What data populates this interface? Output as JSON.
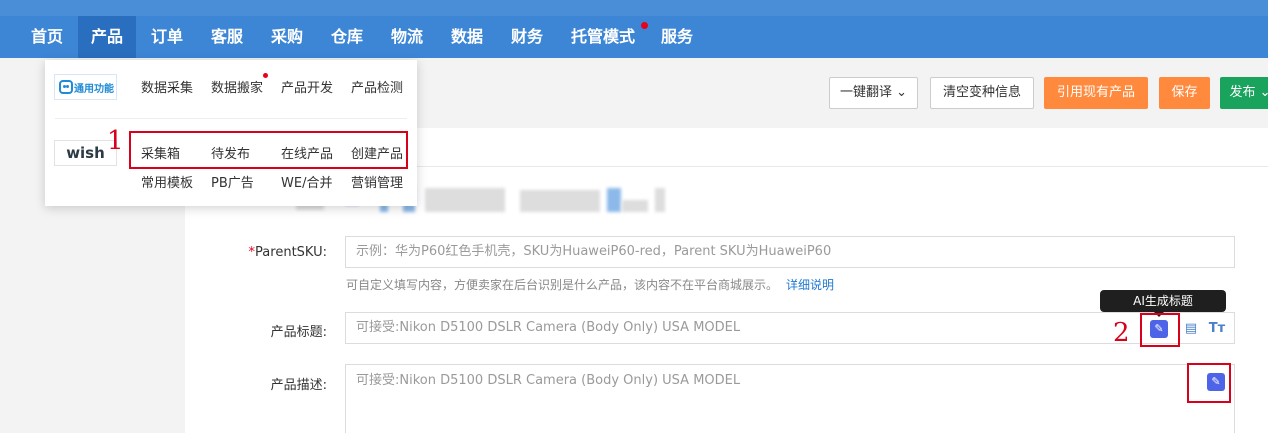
{
  "nav": {
    "items": [
      {
        "label": "首页"
      },
      {
        "label": "产品"
      },
      {
        "label": "订单"
      },
      {
        "label": "客服"
      },
      {
        "label": "采购"
      },
      {
        "label": "仓库"
      },
      {
        "label": "物流"
      },
      {
        "label": "数据"
      },
      {
        "label": "财务"
      },
      {
        "label": "托管模式"
      },
      {
        "label": "服务"
      }
    ],
    "active_index": 1
  },
  "dropdown": {
    "general_logo_text": "通用功能",
    "general_links": [
      "数据采集",
      "数据搬家",
      "产品开发",
      "产品检测"
    ],
    "wish_logo_text": "wish",
    "wish_links_row1": [
      "采集箱",
      "待发布",
      "在线产品",
      "创建产品"
    ],
    "wish_links_row2": [
      "常用模板",
      "PB广告",
      "WE/合并",
      "营销管理"
    ]
  },
  "toolbar": {
    "translate_label": "一键翻译 ⌄",
    "clear_variant_label": "清空变种信息",
    "quote_product_label": "引用现有产品",
    "save_label": "保存",
    "publish_label": "发布 ⌄"
  },
  "form": {
    "parent_sku": {
      "label": "ParentSKU:",
      "required_mark": "*",
      "placeholder": "示例：华为P60红色手机壳，SKU为HuaweiP60-red，Parent SKU为HuaweiP60",
      "hint": "可自定义填写内容，方便卖家在后台识别是什么产品，该内容不在平台商城展示。",
      "hint_link": "详细说明"
    },
    "title": {
      "label": "产品标题:",
      "placeholder": "可接受:Nikon D5100 DSLR Camera (Body Only) USA MODEL"
    },
    "description": {
      "label": "产品描述:",
      "placeholder": "可接受:Nikon D5100 DSLR Camera (Body Only) USA MODEL"
    }
  },
  "tooltip": {
    "ai_title": "AI生成标题"
  },
  "annotations": {
    "one": "1",
    "two": "2"
  },
  "colors": {
    "nav_bg": "#3d86d6",
    "nav_active": "#2a6fbf",
    "orange": "#ff8a3d",
    "green": "#1aa35c",
    "annotation_red": "#d9001b",
    "ai_icon": "#4d63e8"
  }
}
